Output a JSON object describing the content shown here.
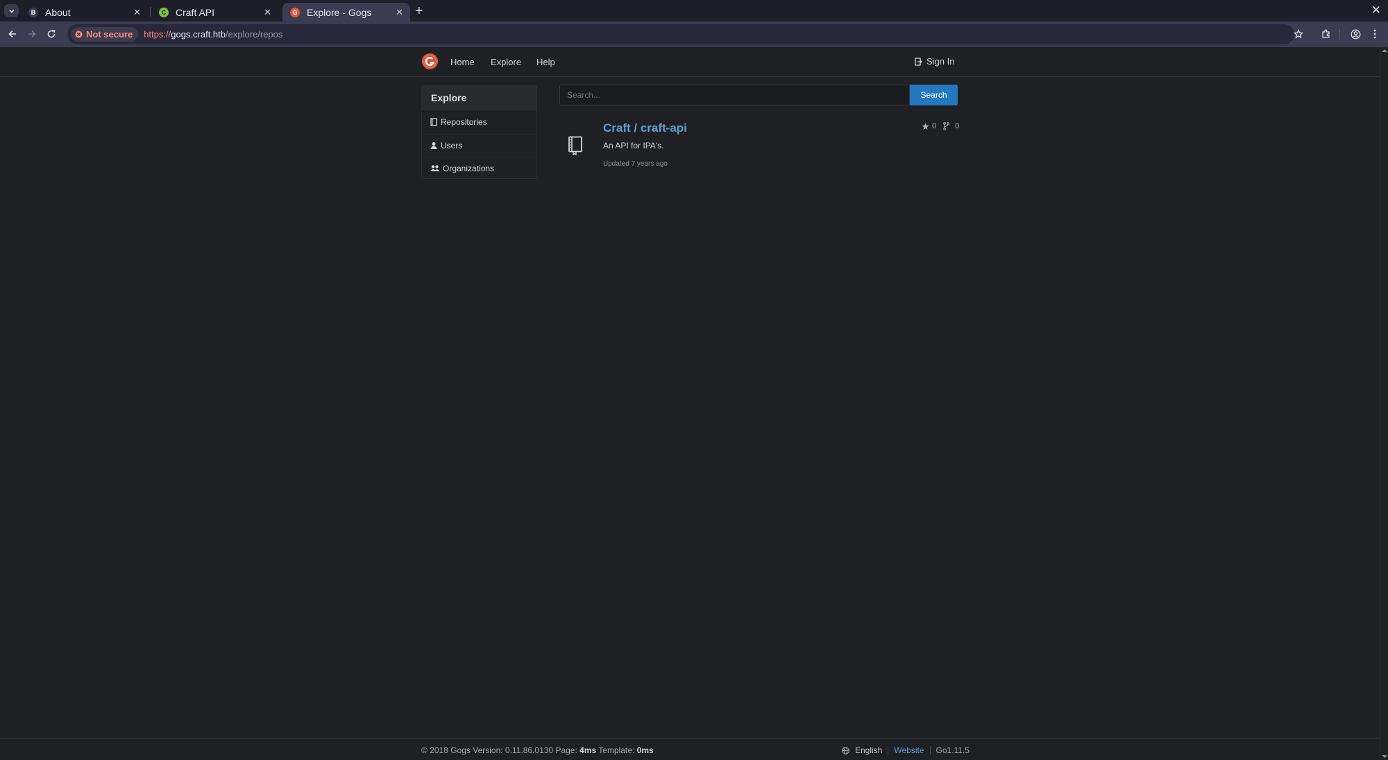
{
  "browser": {
    "tabs": [
      {
        "title": "About",
        "favicon": "B"
      },
      {
        "title": "Craft API",
        "favicon": "C"
      },
      {
        "title": "Explore - Gogs",
        "favicon": "G"
      }
    ],
    "security_label": "Not secure",
    "url": {
      "proto": "https://",
      "host": "gogs.craft.htb",
      "path": "/explore/repos"
    }
  },
  "nav": {
    "home": "Home",
    "explore": "Explore",
    "help": "Help",
    "sign_in": "Sign In"
  },
  "sidebar": {
    "header": "Explore",
    "items": [
      {
        "label": "Repositories",
        "icon": "repo-icon"
      },
      {
        "label": "Users",
        "icon": "person-icon"
      },
      {
        "label": "Organizations",
        "icon": "organization-icon"
      }
    ]
  },
  "search": {
    "placeholder": "Search...",
    "button": "Search"
  },
  "repos": [
    {
      "title": "Craft / craft-api",
      "description": "An API for IPA's.",
      "updated": "Updated 7 years ago",
      "stars": "0",
      "forks": "0"
    }
  ],
  "footer": {
    "copyright": "© 2018 Gogs Version: 0.11.86.0130 Page:",
    "page_time": "4ms",
    "template_label": "Template:",
    "template_time": "0ms",
    "language": "English",
    "website": "Website",
    "go_version": "Go1.11.5"
  },
  "colors": {
    "accent": "#2578bf",
    "link": "#5a9fd6",
    "background": "#1f2023",
    "insecure": "#ff8a80"
  }
}
